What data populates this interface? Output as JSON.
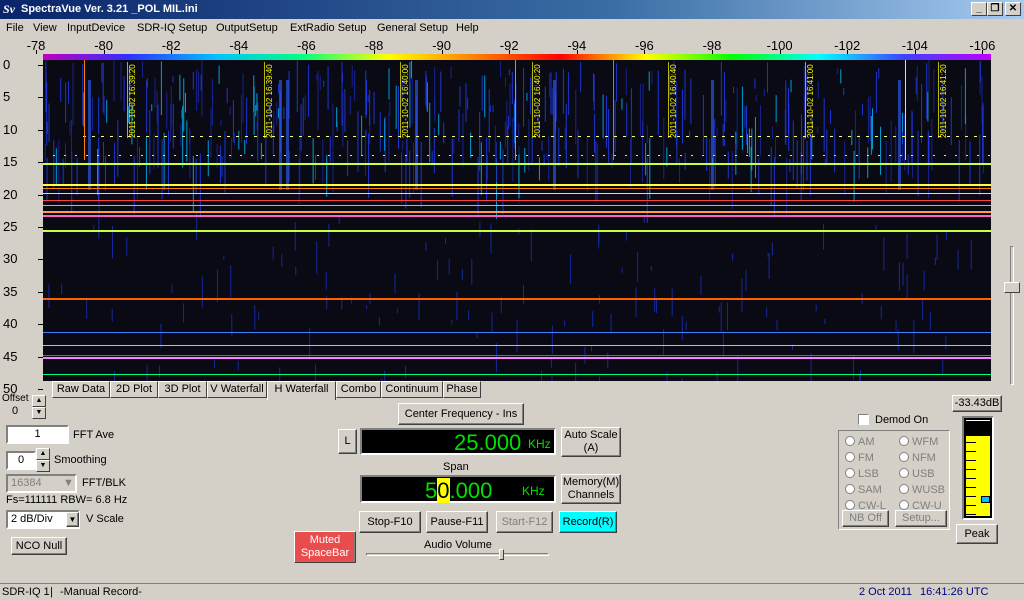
{
  "window": {
    "title": "SpectraVue Ver. 3.21  _POL MIL.ini",
    "icon_label": "Sv",
    "minimize": "_",
    "restore": "❐",
    "close": "✕"
  },
  "menu": [
    "File",
    "View",
    "InputDevice",
    "SDR-IQ Setup",
    "OutputSetup",
    "ExtRadio Setup",
    "General Setup",
    "Help"
  ],
  "freq_axis": [
    "-78",
    "-80",
    "-82",
    "-84",
    "-86",
    "-88",
    "-90",
    "-92",
    "-94",
    "-96",
    "-98",
    "-100",
    "-102",
    "-104",
    "-106"
  ],
  "time_axis": [
    "0",
    "5",
    "10",
    "15",
    "20",
    "25",
    "30",
    "35",
    "40",
    "45",
    "50"
  ],
  "timestamps": [
    "2011-10-02 16:39:20",
    "2011-10-02 16:39:40",
    "2011-10-02 16:40:00",
    "2011-10-02 16:40:20",
    "2011-10-02 16:40:40",
    "2011-10-02 16:41:00",
    "2011-10-02 16:41:20"
  ],
  "tabs": [
    "Raw Data",
    "2D Plot",
    "3D Plot",
    "V Waterfall",
    "H Waterfall",
    "Combo",
    "Continuum",
    "Phase"
  ],
  "active_tab": "H Waterfall",
  "offset": {
    "label": "Offset",
    "value": "0"
  },
  "fft_ave": {
    "value": "1",
    "label": "FFT Ave"
  },
  "smoothing": {
    "value": "0",
    "label": "Smoothing"
  },
  "fft_blk": {
    "value": "16384",
    "label": "FFT/BLK"
  },
  "fs_text": "Fs=111111 RBW= 6.8 Hz",
  "vscale": {
    "value": "2 dB/Div",
    "label": "V Scale"
  },
  "nco_null": "NCO Null",
  "center_freq_button": "Center Frequency - Ins",
  "l_button": "L",
  "center_freq": {
    "value": "25.000",
    "unit": "KHz"
  },
  "auto_scale": {
    "line1": "Auto Scale",
    "line2": "(A)"
  },
  "span": {
    "label": "Span",
    "value_pre": "5",
    "value_hl": "0",
    "value_post": ".000",
    "unit": "KHz"
  },
  "memory": {
    "line1": "Memory(M)",
    "line2": "Channels"
  },
  "stop_button": "Stop-F10",
  "pause_button": "Pause-F11",
  "start_button": "Start-F12",
  "record_button": "Record(R)",
  "muted": {
    "line1": "Muted",
    "line2": "SpaceBar"
  },
  "audio_volume": "Audio Volume",
  "demod_on": "Demod On",
  "modes": [
    [
      "AM",
      "WFM"
    ],
    [
      "FM",
      "NFM"
    ],
    [
      "LSB",
      "USB"
    ],
    [
      "SAM",
      "WUSB"
    ],
    [
      "CW-L",
      "CW-U"
    ]
  ],
  "nb_off": "NB Off",
  "setup": "Setup...",
  "level": "-33.43dB",
  "peak": "Peak",
  "status": {
    "device": "SDR-IQ 1",
    "mode": "-Manual Record-",
    "date": "2 Oct 2011",
    "time": "16:41:26 UTC"
  },
  "colors": {
    "lcd": "#00e000",
    "record": "#00ffff",
    "muted": "#e84c4c",
    "meter": "#ffff00"
  }
}
